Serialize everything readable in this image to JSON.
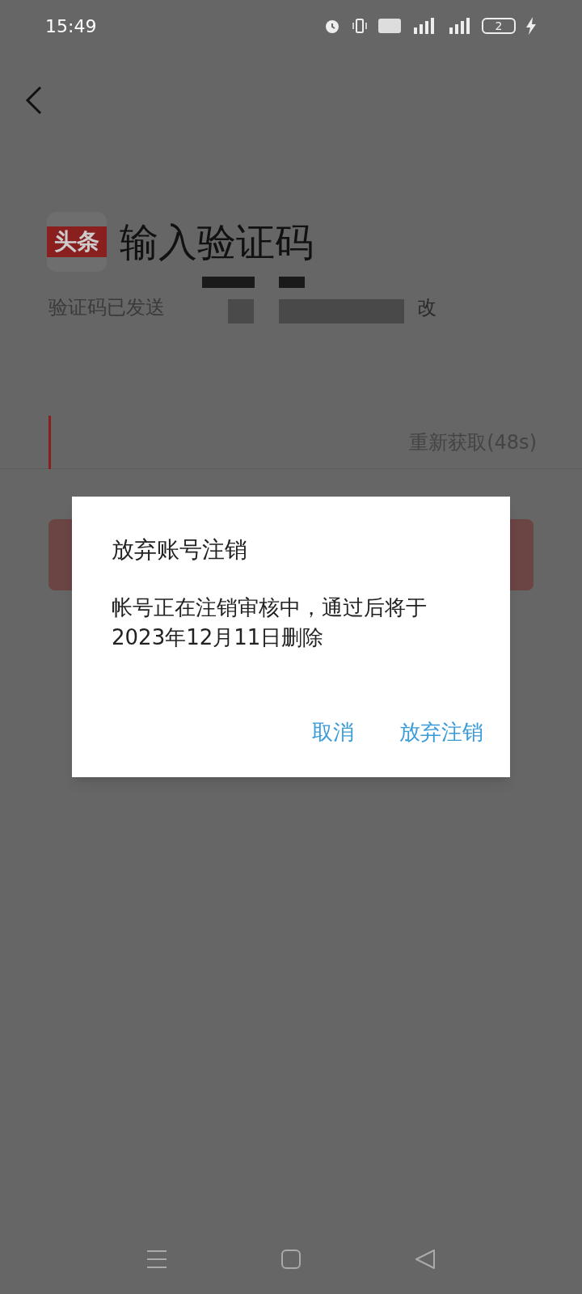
{
  "status_bar": {
    "time": "15:49",
    "battery": "2"
  },
  "header": {
    "logo_text": "头条",
    "title": "输入验证码",
    "subtitle": "验证码已发送",
    "change_link": "改"
  },
  "code_input": {
    "resend": "重新获取(48s)"
  },
  "dialog": {
    "title": "放弃账号注销",
    "message": "帐号正在注销审核中，通过后将于2023年12月11日删除",
    "buttons": [
      "取消",
      "放弃注销"
    ]
  }
}
